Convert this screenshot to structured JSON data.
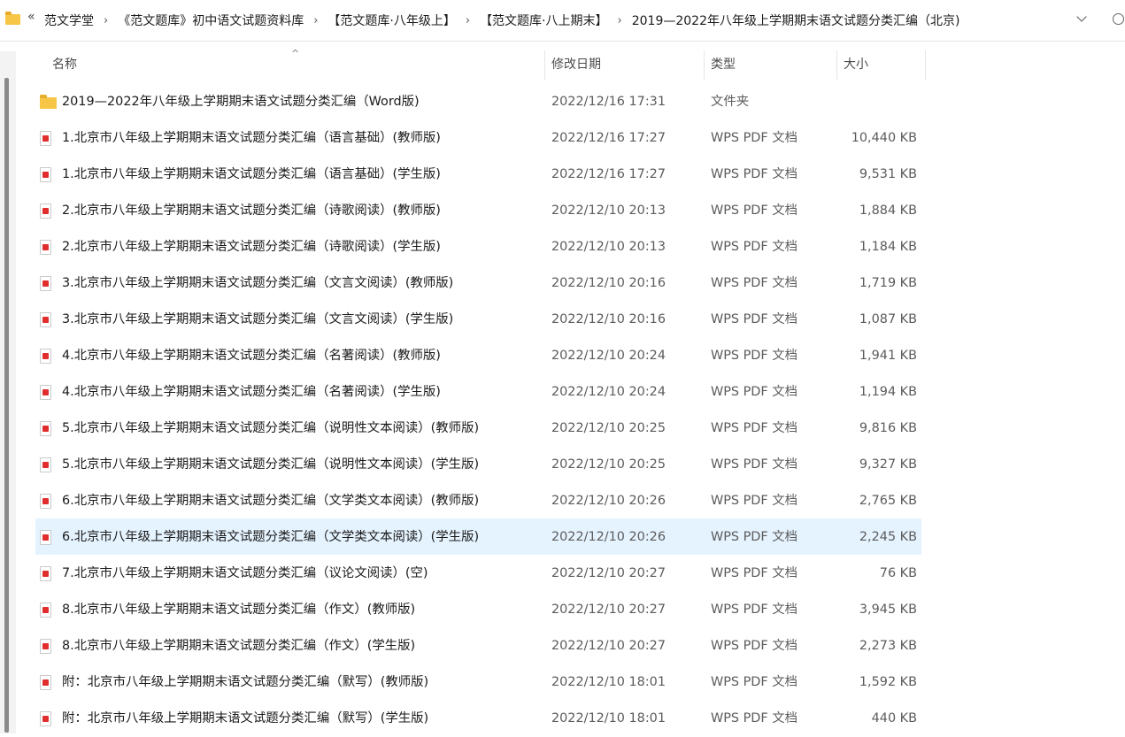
{
  "breadcrumb": {
    "overflow": "«",
    "items": [
      "范文学堂",
      "《范文题库》初中语文试题资料库",
      "【范文题库·八年级上】",
      "【范文题库·八上期末】",
      "2019—2022年八年级上学期期末语文试题分类汇编（北京)"
    ],
    "separator": "›"
  },
  "columns": {
    "name": "名称",
    "date": "修改日期",
    "type": "类型",
    "size": "大小",
    "sort_indicator": "^"
  },
  "files": [
    {
      "name": "2019—2022年八年级上学期期末语文试题分类汇编（Word版)",
      "date": "2022/12/16 17:31",
      "type": "文件夹",
      "size": "",
      "icon": "folder-icon"
    },
    {
      "name": "1.北京市八年级上学期期末语文试题分类汇编（语言基础）(教师版)",
      "date": "2022/12/16 17:27",
      "type": "WPS PDF 文档",
      "size": "10,440 KB",
      "icon": "pdf-icon"
    },
    {
      "name": "1.北京市八年级上学期期末语文试题分类汇编（语言基础）(学生版)",
      "date": "2022/12/16 17:27",
      "type": "WPS PDF 文档",
      "size": "9,531 KB",
      "icon": "pdf-icon"
    },
    {
      "name": "2.北京市八年级上学期期末语文试题分类汇编（诗歌阅读）(教师版)",
      "date": "2022/12/10 20:13",
      "type": "WPS PDF 文档",
      "size": "1,884 KB",
      "icon": "pdf-icon"
    },
    {
      "name": "2.北京市八年级上学期期末语文试题分类汇编（诗歌阅读）(学生版)",
      "date": "2022/12/10 20:13",
      "type": "WPS PDF 文档",
      "size": "1,184 KB",
      "icon": "pdf-icon"
    },
    {
      "name": "3.北京市八年级上学期期末语文试题分类汇编（文言文阅读）(教师版)",
      "date": "2022/12/10 20:16",
      "type": "WPS PDF 文档",
      "size": "1,719 KB",
      "icon": "pdf-icon"
    },
    {
      "name": "3.北京市八年级上学期期末语文试题分类汇编（文言文阅读）(学生版)",
      "date": "2022/12/10 20:16",
      "type": "WPS PDF 文档",
      "size": "1,087 KB",
      "icon": "pdf-icon"
    },
    {
      "name": "4.北京市八年级上学期期末语文试题分类汇编（名著阅读）(教师版)",
      "date": "2022/12/10 20:24",
      "type": "WPS PDF 文档",
      "size": "1,941 KB",
      "icon": "pdf-icon"
    },
    {
      "name": "4.北京市八年级上学期期末语文试题分类汇编（名著阅读）(学生版)",
      "date": "2022/12/10 20:24",
      "type": "WPS PDF 文档",
      "size": "1,194 KB",
      "icon": "pdf-icon"
    },
    {
      "name": "5.北京市八年级上学期期末语文试题分类汇编（说明性文本阅读）(教师版)",
      "date": "2022/12/10 20:25",
      "type": "WPS PDF 文档",
      "size": "9,816 KB",
      "icon": "pdf-icon"
    },
    {
      "name": "5.北京市八年级上学期期末语文试题分类汇编（说明性文本阅读）(学生版)",
      "date": "2022/12/10 20:25",
      "type": "WPS PDF 文档",
      "size": "9,327 KB",
      "icon": "pdf-icon"
    },
    {
      "name": "6.北京市八年级上学期期末语文试题分类汇编（文学类文本阅读）(教师版)",
      "date": "2022/12/10 20:26",
      "type": "WPS PDF 文档",
      "size": "2,765 KB",
      "icon": "pdf-icon"
    },
    {
      "name": "6.北京市八年级上学期期末语文试题分类汇编（文学类文本阅读）(学生版)",
      "date": "2022/12/10 20:26",
      "type": "WPS PDF 文档",
      "size": "2,245 KB",
      "icon": "pdf-icon",
      "selected": true
    },
    {
      "name": "7.北京市八年级上学期期末语文试题分类汇编（议论文阅读）(空)",
      "date": "2022/12/10 20:27",
      "type": "WPS PDF 文档",
      "size": "76 KB",
      "icon": "pdf-icon"
    },
    {
      "name": "8.北京市八年级上学期期末语文试题分类汇编（作文）(教师版)",
      "date": "2022/12/10 20:27",
      "type": "WPS PDF 文档",
      "size": "3,945 KB",
      "icon": "pdf-icon"
    },
    {
      "name": "8.北京市八年级上学期期末语文试题分类汇编（作文）(学生版)",
      "date": "2022/12/10 20:27",
      "type": "WPS PDF 文档",
      "size": "2,273 KB",
      "icon": "pdf-icon"
    },
    {
      "name": "附：北京市八年级上学期期末语文试题分类汇编（默写）(教师版)",
      "date": "2022/12/10 18:01",
      "type": "WPS PDF 文档",
      "size": "1,592 KB",
      "icon": "pdf-icon"
    },
    {
      "name": "附：北京市八年级上学期期末语文试题分类汇编（默写）(学生版)",
      "date": "2022/12/10 18:01",
      "type": "WPS PDF 文档",
      "size": "440 KB",
      "icon": "pdf-icon"
    }
  ],
  "colors": {
    "selected_row": "#e5f3ff",
    "folder": "#f8c646",
    "pdf_accent": "#e02e2e"
  }
}
